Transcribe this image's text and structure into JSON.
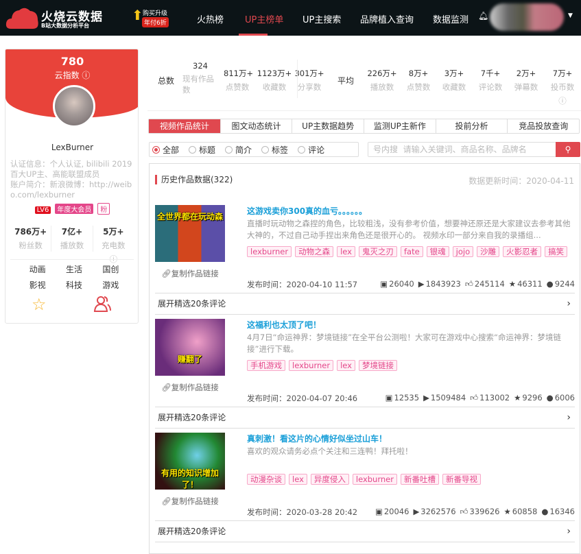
{
  "header": {
    "brand": "火烧云数据",
    "brand_sub": "B站大数据分析平台",
    "promo_line1": "购买升级",
    "promo_line2": "年付6折",
    "nav": [
      "火热榜",
      "UP主榜单",
      "UP主搜索",
      "品牌植入查询",
      "数据监测"
    ],
    "active_nav": 1
  },
  "profile": {
    "score": "780",
    "score_label": "云指数",
    "name": "LexBurner",
    "info": "认证信息：个人认证, bilibili 2019百大UP主、高能联盟成员",
    "bio": "账户简介：新浪微博：http://weibo.com/lexburner",
    "badges": [
      "LV6",
      "年度大会员",
      "粉"
    ],
    "stats": [
      {
        "value": "786万+",
        "label": "粉丝数"
      },
      {
        "value": "7亿+",
        "label": "播放数"
      },
      {
        "value": "5万+",
        "label": "充电数"
      }
    ],
    "categories": [
      "动画",
      "生活",
      "国创",
      "影视",
      "科技",
      "游戏"
    ]
  },
  "summary": {
    "total_label": "总数",
    "avg_label": "平均",
    "totals": [
      {
        "value": "324",
        "label": "现有作品数"
      },
      {
        "value": "811万+",
        "label": "点赞数"
      },
      {
        "value": "1123万+",
        "label": "收藏数"
      },
      {
        "value": "301万+",
        "label": "分享数"
      }
    ],
    "averages": [
      {
        "value": "226万+",
        "label": "播放数"
      },
      {
        "value": "8万+",
        "label": "点赞数"
      },
      {
        "value": "3万+",
        "label": "收藏数"
      },
      {
        "value": "7千+",
        "label": "评论数"
      },
      {
        "value": "2万+",
        "label": "弹幕数"
      },
      {
        "value": "7万+",
        "label": "投币数"
      }
    ]
  },
  "tabs": [
    "视频作品统计",
    "图文动态统计",
    "UP主数据趋势",
    "监测UP主新作",
    "投前分析",
    "竞品投放查询"
  ],
  "filters": [
    "全部",
    "标题",
    "简介",
    "标签",
    "评论"
  ],
  "search": {
    "placeholder": "号内搜  请输入关键词、商品名称、品牌名"
  },
  "panel": {
    "title": "历史作品数据(322)",
    "updated": "数据更新时间：2020-04-11",
    "copy_label": "复制作品链接",
    "expand_label": "展开精选20条评论",
    "videos": [
      {
        "caption": "全世界都在玩动森",
        "title": "这游戏卖你300真的血亏。。。。。。",
        "desc": "直播时玩动物之森捏的角色，比较粗浅，没有参考价值，想要神还原还是大家建议去参考其他大神的，不过自己动手捏出来角色还是很开心的。 视频水印一部分来自我的录播组...",
        "tags": [
          "lexburner",
          "动物之森",
          "lex",
          "鬼灭之刃",
          "fate",
          "银魂",
          "jojo",
          "沙雕",
          "火影忍者",
          "搞笑"
        ],
        "published": "发布时间：2020-04-10 11:57",
        "danmaku": "26040",
        "plays": "1843923",
        "likes": "245114",
        "favorites": "46311",
        "comments": "9244"
      },
      {
        "caption": "赚翻了",
        "title": "这福利也太顶了吧！",
        "desc": "4月7日“命运神界：梦境链接”在全平台公测啦！大家可在游戏中心搜索“命运神界：梦境链接”进行下载。",
        "tags": [
          "手机游戏",
          "lexburner",
          "lex",
          "梦境链接"
        ],
        "published": "发布时间：2020-04-07 20:46",
        "danmaku": "12535",
        "plays": "1509484",
        "likes": "113002",
        "favorites": "9296",
        "comments": "6006"
      },
      {
        "caption": "有用的知识增加了！",
        "title": "真刺激！看这片的心情好似坐过山车！",
        "desc": "喜欢的观众请务必点个关注和三连鸭！拜托啦！",
        "tags": [
          "动漫杂谈",
          "lex",
          "异度侵入",
          "lexburner",
          "新番吐槽",
          "新番导视"
        ],
        "published": "发布时间：2020-03-28 20:42",
        "danmaku": "20046",
        "plays": "3262576",
        "likes": "339626",
        "favorites": "60858",
        "comments": "16346"
      }
    ]
  },
  "colors": {
    "accent": "#e0484f",
    "header_bg": "#0c1417",
    "title_blue": "#1a9fd8",
    "tag_pink": "#e4478a"
  }
}
